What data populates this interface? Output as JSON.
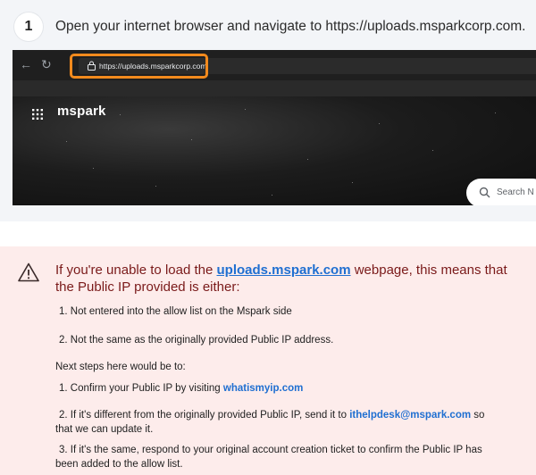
{
  "step": {
    "number": "1",
    "text": "Open your internet browser and navigate to https://uploads.msparkcorp.com."
  },
  "browser": {
    "back_icon": "arrow-left-icon",
    "reload_icon": "reload-icon",
    "url": "https://uploads.msparkcorp.com",
    "highlight_color": "#f28a1d",
    "site_logo": "mspark",
    "search_placeholder": "Search N"
  },
  "callout": {
    "icon": "warning-triangle-icon",
    "title_before": "If you're unable to load the ",
    "title_link": "uploads.mspark.com",
    "title_after": " webpage, this means that the Public IP provided is either:",
    "reasons": [
      "1. Not entered into the allow list on the Mspark side",
      "2. Not the same as the originally provided Public IP address."
    ],
    "next_steps_label": "Next steps here would be to:",
    "step1_before": "1. Confirm your Public IP by visiting ",
    "step1_link": "whatismyip.com",
    "step2_before": "2. If it's different from the originally provided Public IP, send it to ",
    "step2_link": "ithelpdesk@mspark.com",
    "step2_after": " so",
    "step2_line2": "that we can update it.",
    "step3_line1": "3. If it's the same, respond to your original account creation ticket to confirm the Public IP has",
    "step3_line2": "been added to the allow list.",
    "link_color": "#1f6fd1",
    "title_color": "#7a1a1a"
  }
}
